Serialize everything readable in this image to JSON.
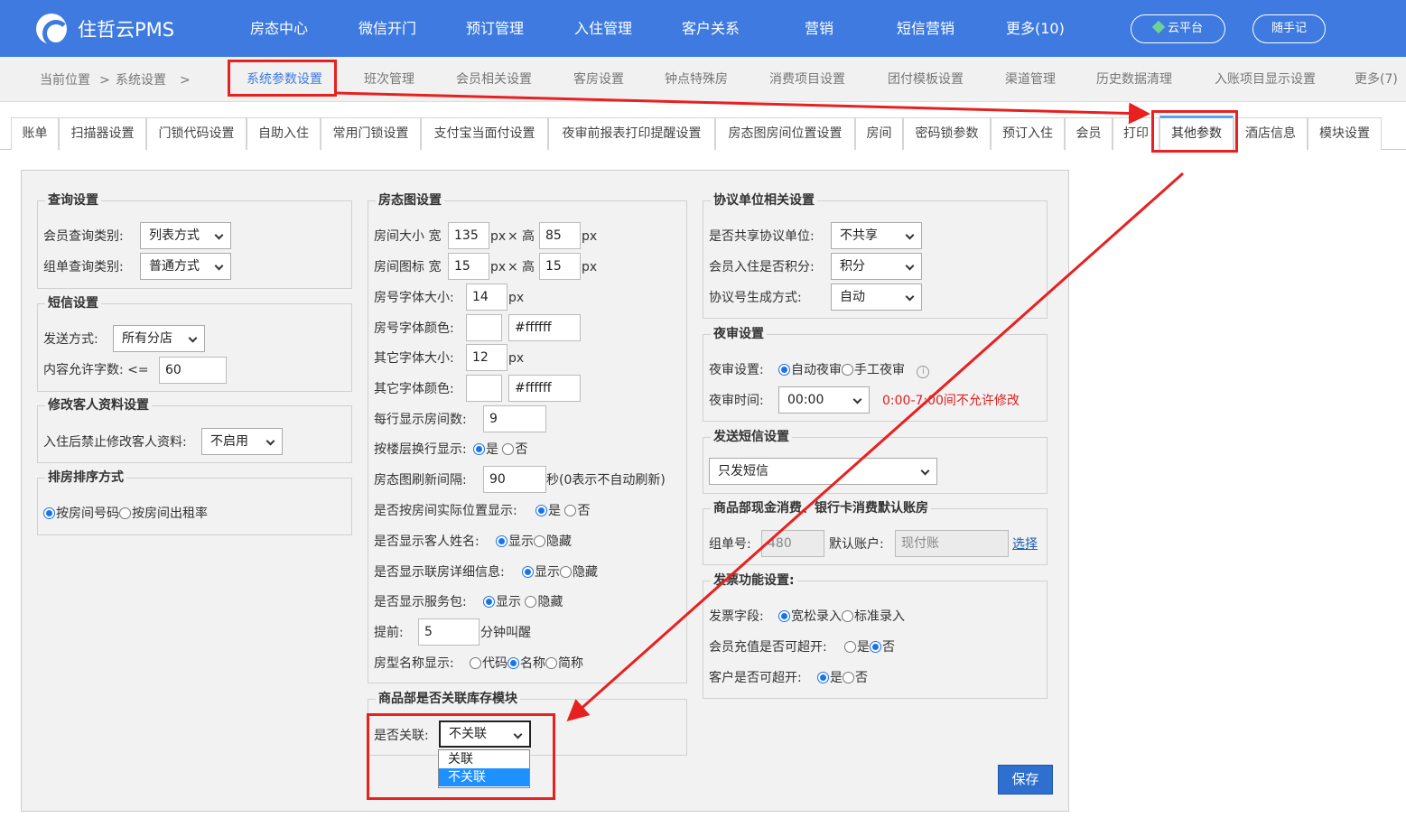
{
  "app": {
    "name": "住哲云PMS"
  },
  "topnav": {
    "items": [
      "房态中心",
      "微信开门",
      "预订管理",
      "入住管理",
      "客户关系",
      "营销",
      "短信营销",
      "更多(10)"
    ],
    "cloud": "云平台",
    "note": "随手记"
  },
  "crumb": {
    "label": "当前位置",
    "sep": ">",
    "section": "系统设置",
    "sep2": ">"
  },
  "subtabs": [
    "系统参数设置",
    "班次管理",
    "会员相关设置",
    "客房设置",
    "钟点特殊房",
    "消费项目设置",
    "团付模板设置",
    "渠道管理",
    "历史数据清理",
    "入账项目显示设置",
    "更多(7)"
  ],
  "tabs": [
    "账单",
    "扫描器设置",
    "门锁代码设置",
    "自助入住",
    "常用门锁设置",
    "支付宝当面付设置",
    "夜审前报表打印提醒设置",
    "房态图房间位置设置",
    "房间",
    "密码锁参数",
    "预订入住",
    "会员",
    "打印",
    "其他参数",
    "酒店信息",
    "模块设置"
  ],
  "query": {
    "title": "查询设置",
    "member_label": "会员查询类别:",
    "member_value": "列表方式",
    "group_label": "组单查询类别:",
    "group_value": "普通方式"
  },
  "sms": {
    "title": "短信设置",
    "send_label": "发送方式:",
    "send_value": "所有分店",
    "len_label": "内容允许字数: <=",
    "len_value": "60"
  },
  "guest": {
    "title": "修改客人资料设置",
    "label": "入住后禁止修改客人资料:",
    "value": "不启用"
  },
  "sort": {
    "title": "排房排序方式",
    "opt1": "按房间号码",
    "opt2": "按房间出租率"
  },
  "roommap": {
    "title": "房态图设置",
    "size_label": "房间大小 宽",
    "size_w": "135",
    "px": "px",
    "x": "×",
    "h": "高",
    "size_h": "85",
    "icon_label": "房间图标 宽",
    "icon_w": "15",
    "icon_h": "15",
    "numfont_label": "房号字体大小:",
    "numfont": "14",
    "numcolor_label": "房号字体颜色:",
    "numcolor": "#ffffff",
    "otherfont_label": "其它字体大小:",
    "otherfont": "12",
    "othercolor_label": "其它字体颜色:",
    "othercolor": "#ffffff",
    "perrow_label": "每行显示房间数:",
    "perrow": "9",
    "floor_label": "按楼层换行显示:",
    "yes": "是",
    "no": "否",
    "refresh_label": "房态图刷新间隔:",
    "refresh": "90",
    "refresh_unit": "秒(0表示不自动刷新)",
    "actualpos_label": "是否按房间实际位置显示:",
    "guestname_label": "是否显示客人姓名:",
    "show": "显示",
    "hide": "隐藏",
    "linkdetail_label": "是否显示联房详细信息:",
    "package_label": "是否显示服务包:",
    "advance_label": "提前:",
    "advance": "5",
    "advance_unit": "分钟叫醒",
    "typename_label": "房型名称显示:",
    "code": "代码",
    "name": "名称",
    "short": "简称"
  },
  "stock": {
    "title": "商品部是否关联库存模块",
    "label": "是否关联:",
    "value": "不关联",
    "options": [
      "关联",
      "不关联"
    ]
  },
  "agreement": {
    "title": "协议单位相关设置",
    "share_label": "是否共享协议单位:",
    "share_value": "不共享",
    "points_label": "会员入住是否积分:",
    "points_value": "积分",
    "gen_label": "协议号生成方式:",
    "gen_value": "自动"
  },
  "audit": {
    "title": "夜审设置",
    "mode_label": "夜审设置:",
    "auto": "自动夜审",
    "manual": "手工夜审",
    "info": "i",
    "time_label": "夜审时间:",
    "time_value": "00:00",
    "warning": "0:00-7:00间不允许修改"
  },
  "sendsms": {
    "title": "发送短信设置",
    "value": "只发短信"
  },
  "goods": {
    "title": "商品部现金消费、银行卡消费默认账房",
    "group_label": "组单号:",
    "group_value": "480",
    "acct_label": "默认账户:",
    "acct_value": "现付账",
    "select": "选择"
  },
  "invoice": {
    "title": "发票功能设置:",
    "field_label": "发票字段:",
    "loose": "宽松录入",
    "strict": "标准录入",
    "member_label": "会员充值是否可超开:",
    "yes": "是",
    "no": "否",
    "customer_label": "客户是否可超开:"
  },
  "save": "保存",
  "colors": {
    "brand": "#3e7ae0",
    "highlight": "#e82020",
    "save": "#2f6fcf"
  }
}
